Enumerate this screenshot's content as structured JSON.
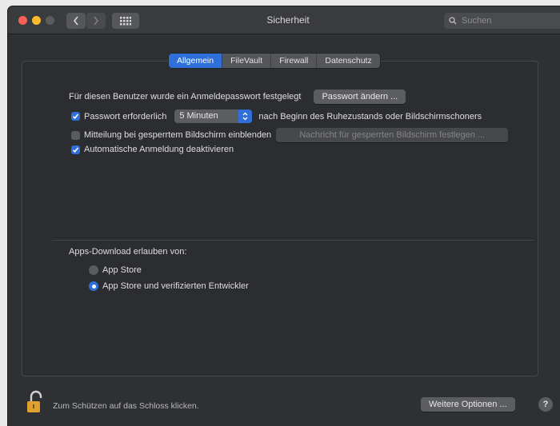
{
  "window": {
    "title": "Sicherheit",
    "search_placeholder": "Suchen"
  },
  "tabs": [
    {
      "label": "Allgemein",
      "active": true
    },
    {
      "label": "FileVault",
      "active": false
    },
    {
      "label": "Firewall",
      "active": false
    },
    {
      "label": "Datenschutz",
      "active": false
    }
  ],
  "general": {
    "password_set_text": "Für diesen Benutzer wurde ein Anmeldepasswort festgelegt",
    "change_password_label": "Passwort ändern ...",
    "require_password": {
      "label": "Passwort erforderlich",
      "checked": true,
      "delay_value": "5 Minuten",
      "suffix": "nach Beginn des Ruhezustands oder Bildschirmschoners"
    },
    "lock_message": {
      "label": "Mitteilung bei gesperrtem Bildschirm einblenden",
      "checked": false,
      "button_label": "Nachricht für gesperrten Bildschirm festlegen ..."
    },
    "auto_login": {
      "label": "Automatische Anmeldung deaktivieren",
      "checked": true
    }
  },
  "downloads": {
    "heading": "Apps-Download erlauben von:",
    "options": [
      {
        "label": "App Store",
        "selected": false
      },
      {
        "label": "App Store und verifizierten Entwickler",
        "selected": true
      }
    ]
  },
  "footer": {
    "lock_text": "Zum Schützen auf das Schloss klicken.",
    "more_options_label": "Weitere Optionen ...",
    "help_label": "?"
  },
  "colors": {
    "accent": "#2f6fd9",
    "window_bg": "#2f3033",
    "lock": "#e0a030"
  }
}
